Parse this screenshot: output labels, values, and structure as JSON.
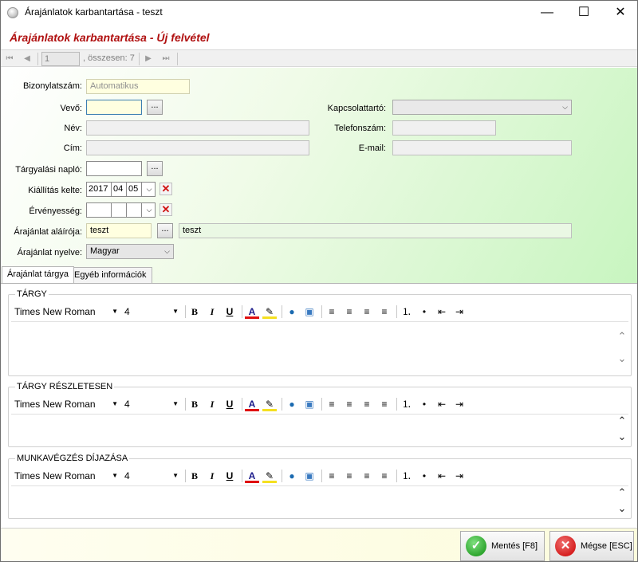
{
  "window": {
    "title": "Árajánlatok karbantartása - teszt",
    "minimize": "—",
    "maximize": "☐",
    "close": "✕"
  },
  "header": {
    "title": "Árajánlatok karbantartása - Új felvétel"
  },
  "navigator": {
    "position": "1",
    "total": ", összesen: 7",
    "first": "⏮",
    "prev": "◀",
    "next": "▶",
    "last": "⏭"
  },
  "form": {
    "doc_number": {
      "label": "Bizonylatszám:",
      "value": "Automatikus"
    },
    "customer": {
      "label": "Vevő:",
      "value": "",
      "btn": "..."
    },
    "name": {
      "label": "Név:",
      "value": ""
    },
    "address": {
      "label": "Cím:",
      "value": ""
    },
    "negotiation_log": {
      "label": "Tárgyalási napló:",
      "value": "",
      "btn": "..."
    },
    "issue_date": {
      "label": "Kiállítás kelte:",
      "year": "2017",
      "month": "04",
      "day": "05",
      "clear": "✕"
    },
    "validity": {
      "label": "Érvényesség:",
      "year": "",
      "month": "",
      "day": "",
      "clear": "✕"
    },
    "signer": {
      "label": "Árajánlat aláírója:",
      "value": "teszt",
      "btn": "...",
      "name_value": "teszt"
    },
    "language": {
      "label": "Árajánlat nyelve:",
      "value": "Magyar"
    },
    "contact": {
      "label": "Kapcsolattartó:",
      "value": ""
    },
    "phone": {
      "label": "Telefonszám:",
      "value": ""
    },
    "email": {
      "label": "E-mail:",
      "value": ""
    }
  },
  "tabs": [
    {
      "label": "Árajánlat tárgya",
      "active": true
    },
    {
      "label": "Egyéb információk",
      "active": false
    }
  ],
  "editors": [
    {
      "title": "TÁRGY",
      "font": "Times New Roman",
      "size": "4"
    },
    {
      "title": "TÁRGY RÉSZLETESEN",
      "font": "Times New Roman",
      "size": "4"
    },
    {
      "title": "MUNKAVÉGZÉS DÍJAZÁSA",
      "font": "Times New Roman",
      "size": "4"
    }
  ],
  "toolbar": {
    "bold": "B",
    "italic": "I",
    "underline": "U",
    "font_color": "A",
    "highlight": "✎",
    "link": "●",
    "image": "▣",
    "align_left": "≡",
    "align_center": "≡",
    "align_right": "≡",
    "justify": "≡",
    "numbered_list": "⒈",
    "bullet_list": "•",
    "outdent": "⇤",
    "indent": "⇥"
  },
  "footer": {
    "save": {
      "label": "Mentés [F8]",
      "icon": "✓"
    },
    "cancel": {
      "label": "Mégse [ESC]",
      "icon": "✕"
    }
  },
  "colors": {
    "header_text": "#b01010",
    "save_icon": "#2fa62f",
    "cancel_icon": "#d62020",
    "gradient_end": "#c8f5c0"
  }
}
